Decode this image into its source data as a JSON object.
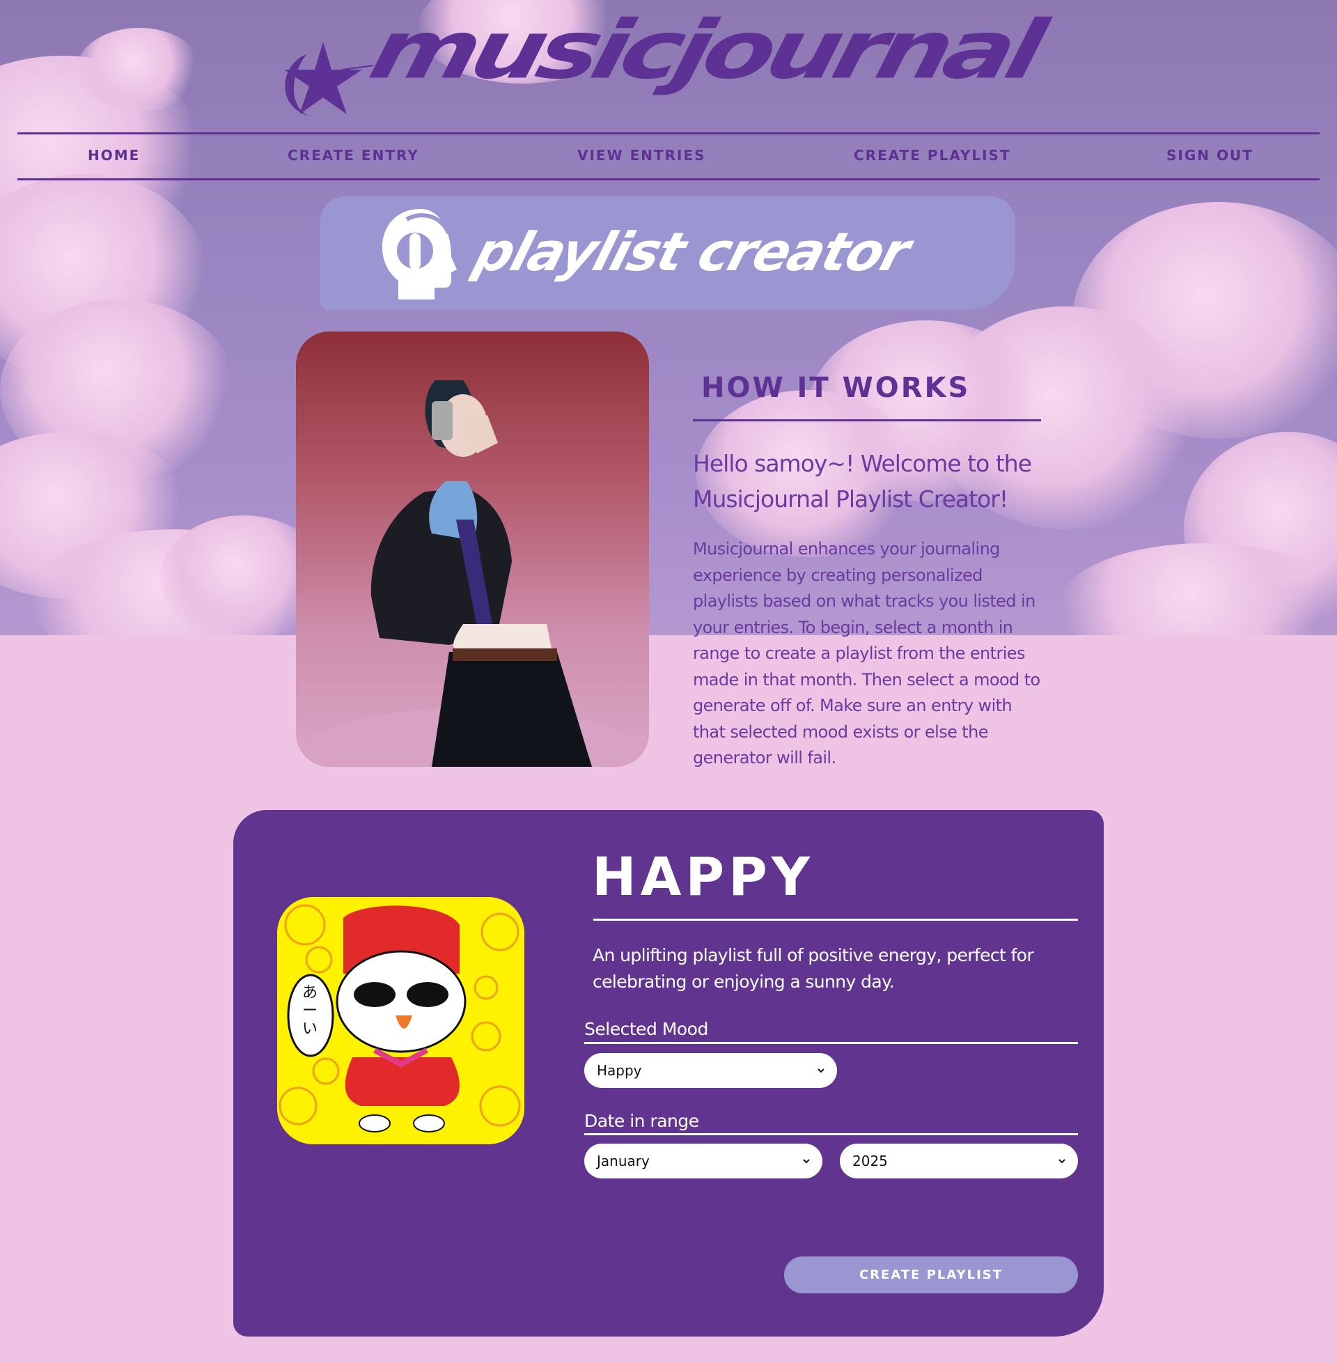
{
  "brand": {
    "logo_text": "musicjournal"
  },
  "nav": {
    "items": [
      {
        "label": "HOME"
      },
      {
        "label": "CREATE ENTRY"
      },
      {
        "label": "VIEW ENTRIES"
      },
      {
        "label": "CREATE PLAYLIST"
      },
      {
        "label": "SIGN OUT"
      }
    ]
  },
  "banner": {
    "title": "playlist creator",
    "icon": "headphones-head-icon"
  },
  "how": {
    "title": "HOW IT WORKS",
    "greeting": "Hello samoy~! Welcome to the Musicjournal Playlist Creator!",
    "body": "Musicjournal enhances your journaling experience by creating personalized playlists based on what tracks you listed in your entries. To begin, select a month in range to create a playlist from the entries made in that month. Then select a mood to generate off of. Make sure an entry with that selected mood exists or else the generator will fail."
  },
  "mood_card": {
    "title": "HAPPY",
    "description": "An uplifting playlist full of positive energy, perfect for celebrating or enjoying a sunny day.",
    "sticker_text": "あーい",
    "selected_mood_label": "Selected Mood",
    "selected_mood_value": "Happy",
    "date_label": "Date in range",
    "month_value": "January",
    "year_value": "2025",
    "create_button": "CREATE PLAYLIST"
  },
  "colors": {
    "accent": "#5e3194",
    "card_bg": "#61358f",
    "banner_bg": "#9a96d1",
    "page_bg": "#efc3e3"
  }
}
